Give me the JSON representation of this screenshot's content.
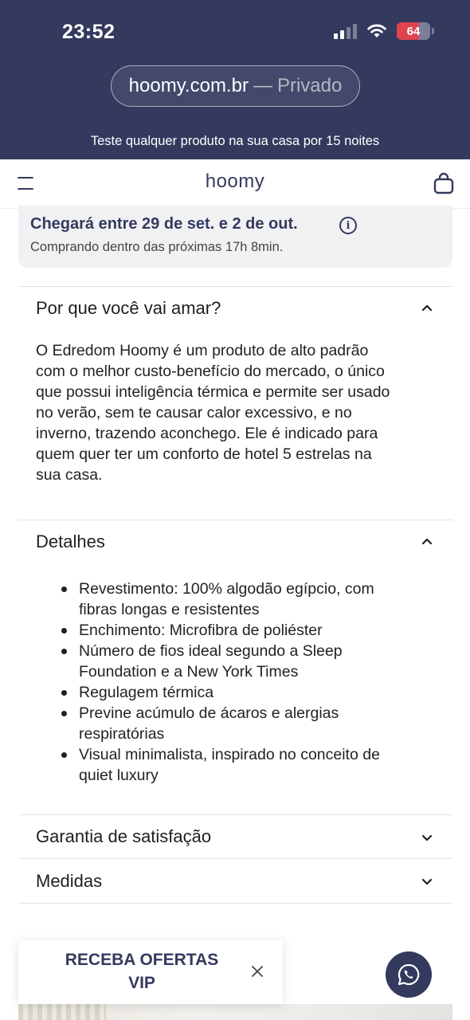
{
  "status_bar": {
    "time": "23:52",
    "battery_level": "64",
    "icons": [
      "cellular-signal-icon",
      "wifi-icon",
      "battery-icon"
    ]
  },
  "browser": {
    "domain": "hoomy.com.br",
    "separator": "—",
    "mode": "Privado"
  },
  "promo_bar": {
    "text": "Teste qualquer produto na sua casa por 15 noites"
  },
  "header": {
    "logo": "hoomy",
    "icons": [
      "menu-icon",
      "shopping-bag-icon"
    ]
  },
  "delivery": {
    "title": "Chegará entre 29 de set. e 2 de out.",
    "subtitle": "Comprando dentro das próximas 17h 8min.",
    "info_symbol": "i"
  },
  "accordions": {
    "why_love": {
      "title": "Por que você vai amar?",
      "expanded": true,
      "lines": [
        "O Edredom Hoomy é um produto de alto padrão",
        "com o melhor custo-benefício do mercado, o único",
        "que possui inteligência térmica e permite ser usado",
        "no verão, sem te causar calor excessivo, e no",
        "inverno, trazendo aconchego. Ele é indicado para",
        "quem quer ter um conforto de hotel 5 estrelas na",
        "sua casa."
      ]
    },
    "details": {
      "title": "Detalhes",
      "expanded": true,
      "items": [
        [
          "Revestimento: 100% algodão egípcio, com",
          "fibras longas e resistentes"
        ],
        [
          "Enchimento: Microfibra de poliéster"
        ],
        [
          "Número de fios ideal segundo a Sleep",
          "Foundation e a New York Times"
        ],
        [
          "Regulagem térmica"
        ],
        [
          "Previne acúmulo de ácaros e alergias",
          "respiratórias"
        ],
        [
          "Visual minimalista, inspirado no conceito de",
          "quiet luxury"
        ]
      ]
    },
    "guarantee": {
      "title": "Garantia de satisfação",
      "expanded": false
    },
    "measures": {
      "title": "Medidas",
      "expanded": false
    }
  },
  "vip_popup": {
    "line1": "RECEBA OFERTAS",
    "line2": "VIP"
  },
  "colors": {
    "brand_navy": "#343a5e",
    "delivery_bg": "#f1f1f4",
    "battery_red": "#e0434f"
  }
}
